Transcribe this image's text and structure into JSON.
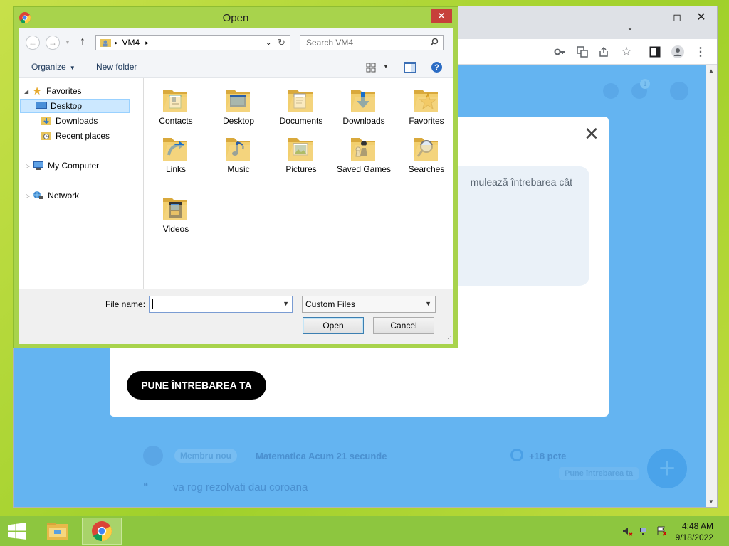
{
  "dialog": {
    "title": "Open",
    "breadcrumb": "VM4",
    "search_placeholder": "Search VM4",
    "organize_label": "Organize",
    "new_folder_label": "New folder",
    "nav": {
      "favorites": "Favorites",
      "desktop": "Desktop",
      "downloads": "Downloads",
      "recent_places": "Recent places",
      "my_computer": "My Computer",
      "network": "Network"
    },
    "folders": [
      {
        "label": "Contacts",
        "icon": "contacts"
      },
      {
        "label": "Desktop",
        "icon": "desktop"
      },
      {
        "label": "Documents",
        "icon": "documents"
      },
      {
        "label": "Downloads",
        "icon": "downloads"
      },
      {
        "label": "Favorites",
        "icon": "favorites"
      },
      {
        "label": "Links",
        "icon": "links"
      },
      {
        "label": "Music",
        "icon": "music"
      },
      {
        "label": "Pictures",
        "icon": "pictures"
      },
      {
        "label": "Saved Games",
        "icon": "saved-games"
      },
      {
        "label": "Searches",
        "icon": "searches"
      },
      {
        "label": "Videos",
        "icon": "videos"
      }
    ],
    "file_name_label": "File name:",
    "file_name_value": "",
    "file_type": "Custom Files",
    "open_label": "Open",
    "cancel_label": "Cancel"
  },
  "web": {
    "question_snippet": "mulează întrebarea cât",
    "ask_button": "PUNE ÎNTREBAREA TA",
    "member_badge": "Membru nou",
    "subject_meta": "Matematica  Acum 21 secunde",
    "points": "+18 pcte",
    "ask_small_button": "Pune întrebarea ta",
    "question_preview": "va rog rezolvati dau coroana",
    "notification_count": "1"
  },
  "taskbar": {
    "time": "4:48 AM",
    "date": "9/18/2022"
  },
  "colors": {
    "dialog_frame": "#a8d34c",
    "taskbar": "#8dc63f",
    "page_overlay": "#64b4f1"
  }
}
